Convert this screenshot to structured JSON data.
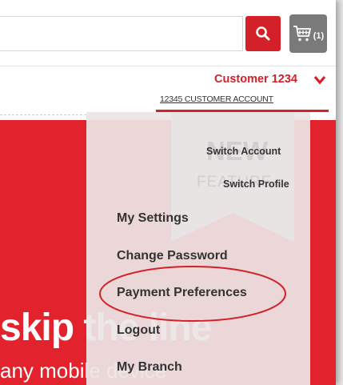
{
  "header": {
    "search_placeholder": "",
    "cart_count": "(1)",
    "customer_name": "Customer 1234",
    "account_label": "12345 CUSTOMER ACCOUNT"
  },
  "dropdown": {
    "badge_new": "NEW",
    "badge_feature": "FEATURE",
    "items": [
      {
        "label": "Switch Account"
      },
      {
        "label": "Switch Profile"
      },
      {
        "label": "My Settings"
      },
      {
        "label": "Change Password"
      },
      {
        "label": "Payment Preferences",
        "highlighted": true
      },
      {
        "label": "Logout"
      },
      {
        "label": "My Branch"
      }
    ]
  },
  "banner": {
    "headline": "skip the line",
    "subline": "any mobile device"
  },
  "colors": {
    "brand_red": "#d32029",
    "cart_gray": "#7a7a7a",
    "highlight_oval": "#d32029"
  }
}
